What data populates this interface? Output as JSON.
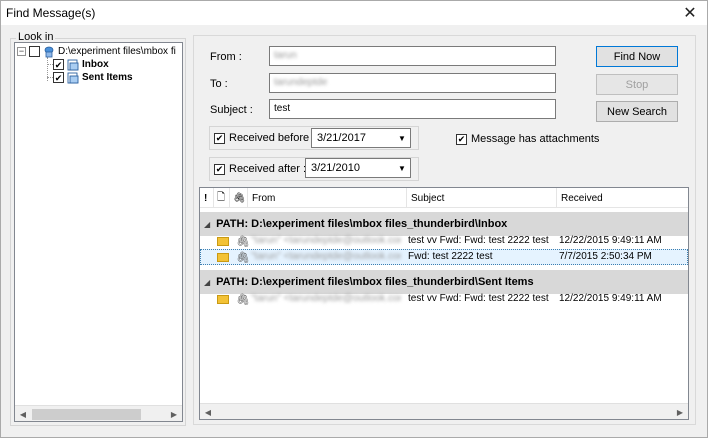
{
  "window": {
    "title": "Find Message(s)",
    "close_glyph": "✕"
  },
  "lookin": {
    "legend": "Look in",
    "root_label": "D:\\experiment files\\mbox fi",
    "expander_glyph": "−",
    "children": [
      {
        "label": "Inbox"
      },
      {
        "label": "Sent Items"
      }
    ]
  },
  "search": {
    "from_label": "From :",
    "from_value": "tarun",
    "to_label": "To :",
    "to_value": "tarundeptde",
    "subject_label": "Subject :",
    "subject_value": "test",
    "received_before_label": "Received before :",
    "received_before_value": "3/21/2017",
    "received_after_label": "Received after :",
    "received_after_value": "3/21/2010",
    "attachments_label": "Message has attachments"
  },
  "buttons": {
    "find_now": "Find Now",
    "stop": "Stop",
    "new_search": "New Search"
  },
  "results": {
    "columns": {
      "importance": "!",
      "doc": "🗋",
      "attach": "🖇",
      "from": "From",
      "subject": "Subject",
      "received": "Received"
    },
    "groups": [
      {
        "path": "PATH: D:\\experiment files\\mbox files_thunderbird\\Inbox",
        "rows": [
          {
            "from": "\"tarun\" <tarundeptde@outlook.com>",
            "subject": "test vv Fwd: Fwd: test 2222 test",
            "received": "12/22/2015 9:49:11 AM"
          },
          {
            "from": "\"tarun\" <tarundeptde@outlook.com>",
            "subject": "Fwd: test 2222 test",
            "received": "7/7/2015 2:50:34 PM"
          }
        ]
      },
      {
        "path": "PATH: D:\\experiment files\\mbox files_thunderbird\\Sent Items",
        "rows": [
          {
            "from": "\"tarun\" <tarundeptde@outlook.com>",
            "subject": "test vv Fwd: Fwd: test 2222 test",
            "received": "12/22/2015 9:49:11 AM"
          }
        ]
      }
    ]
  },
  "glyphs": {
    "dropdown": "▼",
    "scroll_left": "◀",
    "scroll_right": "▶",
    "collapse_tri": "◢"
  },
  "colors": {
    "accent": "#0078d7",
    "selection": "#e5f3ff",
    "group_bg": "#d8d8d8"
  }
}
